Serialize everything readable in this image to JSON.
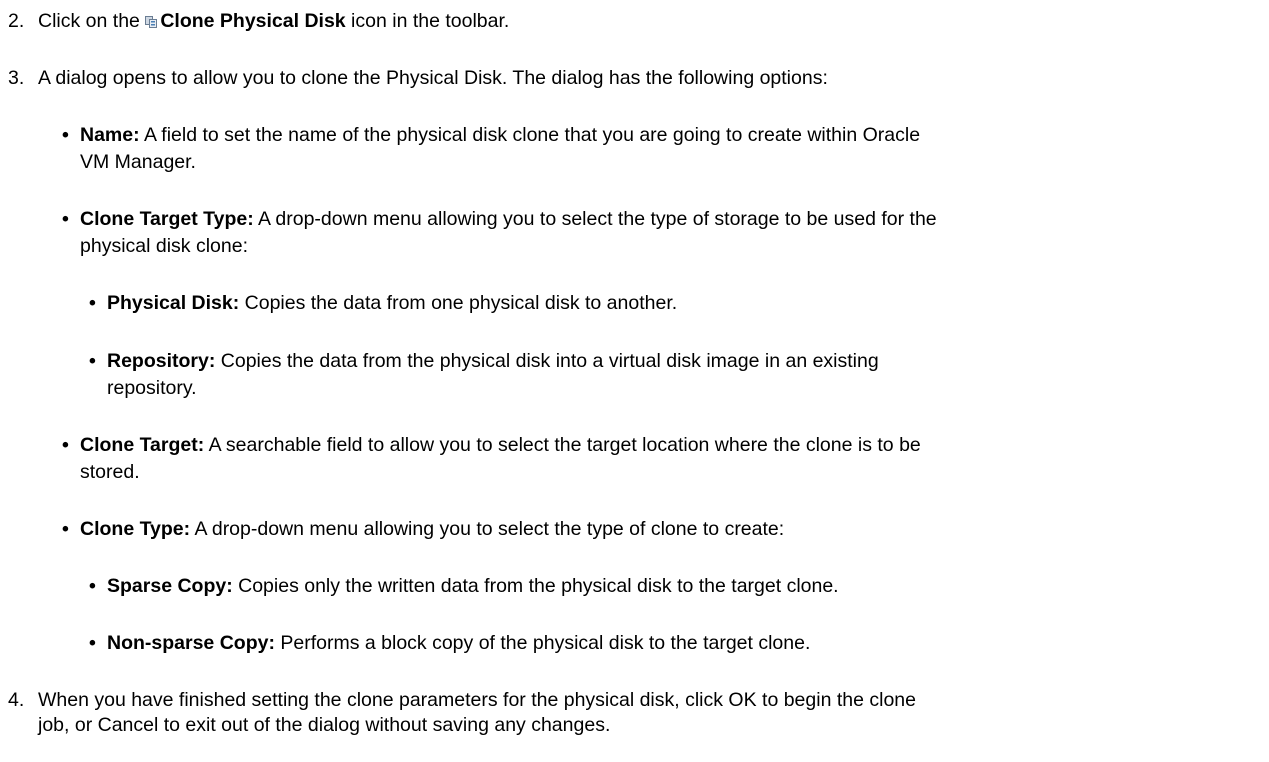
{
  "steps": [
    {
      "number": "2.",
      "prefix": "Click on the ",
      "icon": "clone-physical-disk-icon",
      "bold": "Clone Physical Disk",
      "suffix": " icon in the toolbar."
    },
    {
      "number": "3.",
      "text": "A dialog opens to allow you to clone the Physical Disk. The dialog has the following options:"
    },
    {
      "number": "4.",
      "line1": "When you have finished setting the clone parameters for the physical disk, click OK to begin the clone",
      "line2": "job, or Cancel to exit out of the dialog without saving any changes."
    }
  ],
  "bullet_glyph": "•",
  "options": {
    "name": {
      "term": "Name:",
      "line1": " A field to set the name of the physical disk clone that you are going to create within Oracle",
      "line2": "VM Manager."
    },
    "clone_target_type": {
      "term": "Clone Target Type:",
      "line1": " A drop-down menu allowing you to select the type of storage to be used for the",
      "line2": "physical disk clone:",
      "sub": {
        "physical_disk": {
          "term": "Physical Disk:",
          "line1": " Copies the data from one physical disk to another."
        },
        "repository": {
          "term": "Repository:",
          "line1": " Copies the data from the physical disk into a virtual disk image in an existing",
          "line2": "repository."
        }
      }
    },
    "clone_target": {
      "term": "Clone Target:",
      "line1": " A searchable field to allow you to select the target location where the clone is to be",
      "line2": "stored."
    },
    "clone_type": {
      "term": "Clone Type:",
      "line1": " A drop-down menu allowing you to select the type of clone to create:",
      "sub": {
        "sparse": {
          "term": "Sparse Copy:",
          "line1": " Copies only the written data from the physical disk to the target clone."
        },
        "non_sparse": {
          "term": "Non-sparse Copy:",
          "line1": " Performs a block copy of the physical disk to the target clone."
        }
      }
    }
  }
}
